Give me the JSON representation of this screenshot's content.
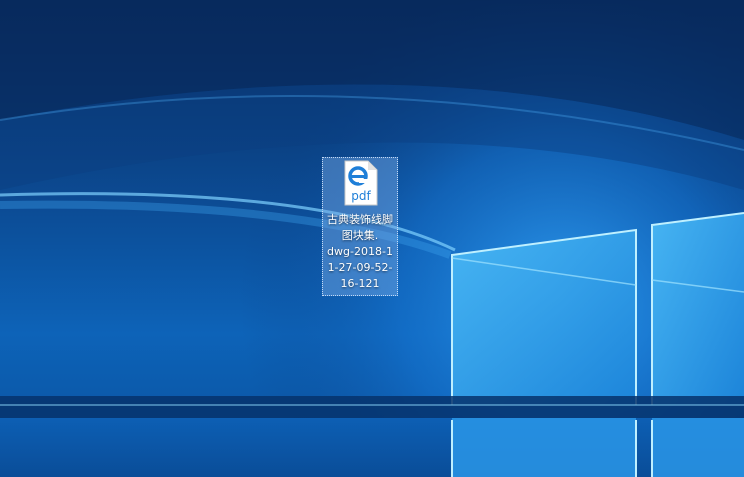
{
  "desktop": {
    "background_color": "#0c4d97",
    "accent_light": "#6fd6ff",
    "icon": {
      "name": "古典装饰线脚图块集.dwg-2018-11-27-09-52-16-121",
      "label_lines": [
        "古典装饰线脚",
        "图块集.",
        "dwg-2018-1",
        "1-27-09-52-",
        "16-121"
      ],
      "type_badge": "pdf",
      "app_icon": "edge-icon",
      "selected": true
    }
  }
}
